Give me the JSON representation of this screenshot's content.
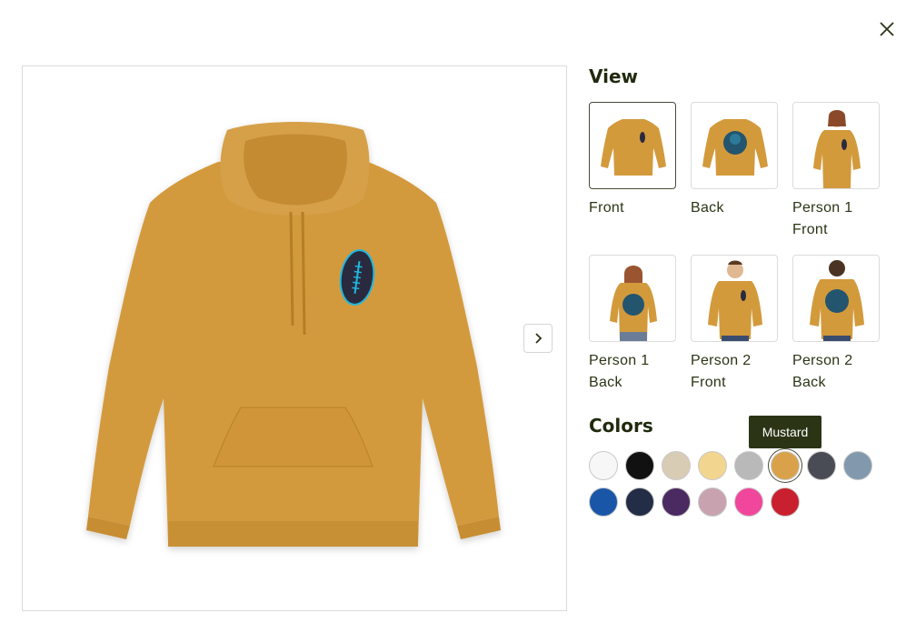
{
  "colors_ui": {
    "mustard": "#d39a3c",
    "mustard_dark": "#b57e26",
    "text": "#1f2a0e",
    "ball": "#2a2a3e",
    "ball_accent": "#1fb8e0"
  },
  "main_image": {
    "alt": "Mustard hoodie front view"
  },
  "view": {
    "title": "View",
    "thumbnails": [
      {
        "label": "Front",
        "selected": true
      },
      {
        "label": "Back",
        "selected": false
      },
      {
        "label": "Person 1\nFront",
        "selected": false
      },
      {
        "label": "Person 1\nBack",
        "selected": false
      },
      {
        "label": "Person 2\nFront",
        "selected": false
      },
      {
        "label": "Person 2\nBack",
        "selected": false
      }
    ]
  },
  "colors": {
    "title": "Colors",
    "tooltip": "Mustard",
    "swatches": [
      {
        "name": "White",
        "hex": "#f7f7f7"
      },
      {
        "name": "Black",
        "hex": "#111111"
      },
      {
        "name": "Sand",
        "hex": "#d9ccb5"
      },
      {
        "name": "Cream",
        "hex": "#f2d68f"
      },
      {
        "name": "Heather Grey",
        "hex": "#b9b9b9"
      },
      {
        "name": "Mustard",
        "hex": "#d9a24a",
        "selected": true
      },
      {
        "name": "Charcoal",
        "hex": "#4a4c55"
      },
      {
        "name": "Slate Blue",
        "hex": "#8299ad"
      },
      {
        "name": "Royal",
        "hex": "#1a56a8"
      },
      {
        "name": "Navy",
        "hex": "#232d45"
      },
      {
        "name": "Purple",
        "hex": "#4a2a60"
      },
      {
        "name": "Light Pink",
        "hex": "#c8a3af"
      },
      {
        "name": "Pink",
        "hex": "#f0479c"
      },
      {
        "name": "Red",
        "hex": "#c8202e"
      }
    ]
  }
}
